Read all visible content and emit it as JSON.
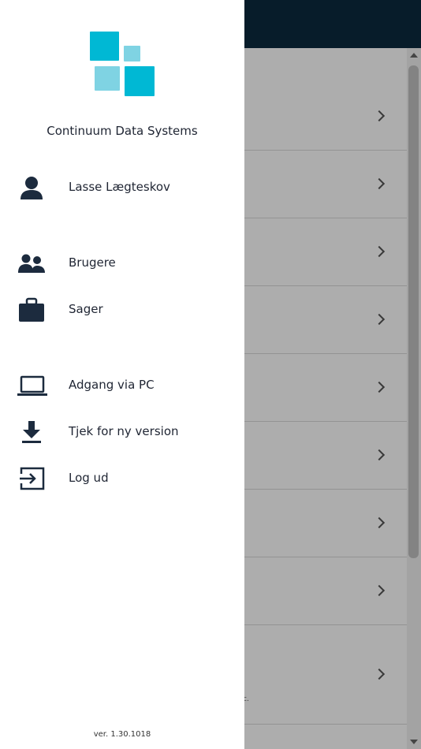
{
  "company_name": "Continuum Data Systems",
  "user": {
    "name": "Lasse Lægteskov",
    "icon": "person-icon"
  },
  "menu": [
    {
      "label": "Brugere",
      "icon": "users-icon"
    },
    {
      "label": "Sager",
      "icon": "briefcase-icon"
    },
    {
      "label": "Adgang via PC",
      "icon": "laptop-icon"
    },
    {
      "label": "Tjek for ny version",
      "icon": "download-icon"
    },
    {
      "label": "Log ud",
      "icon": "logout-icon"
    }
  ],
  "version": "ver. 1.30.1018",
  "background": {
    "partial_text": "c."
  },
  "colors": {
    "header": "#0b2a3f",
    "logo_primary": "#00b8d4",
    "logo_light": "#7fd3e3",
    "icon": "#1c2b3e",
    "text": "#1f2533"
  }
}
